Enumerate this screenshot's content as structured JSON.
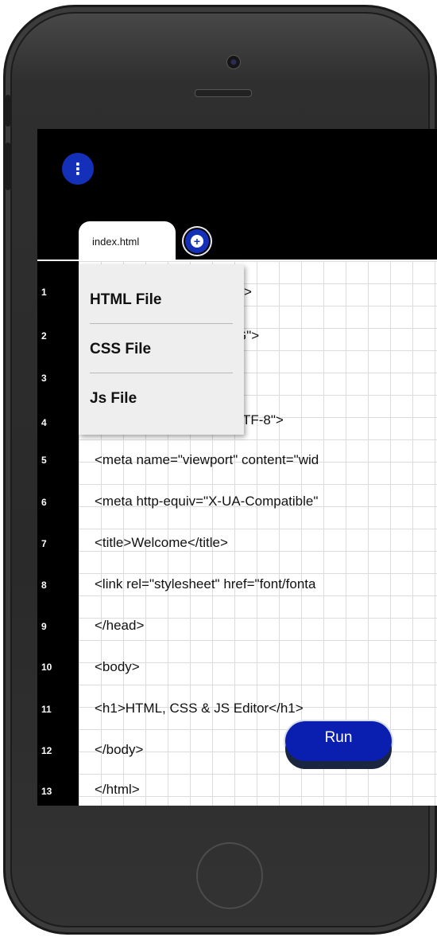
{
  "editor": {
    "tab_label": "index.html",
    "menu_glyph": "⋮",
    "add_glyph": "+",
    "line_numbers": [
      "1",
      "2",
      "3",
      "4",
      "5",
      "6",
      "7",
      "8",
      "9",
      "10",
      "11",
      "12",
      "13"
    ],
    "lines": [
      ">",
      "G\">",
      "",
      "TF-8\">",
      "<meta name=\"viewport\" content=\"wid",
      "<meta http-equiv=\"X-UA-Compatible\"",
      "<title>Welcome</title>",
      "<link rel=\"stylesheet\" href=\"font/fonta",
      "</head>",
      "<body>",
      "<h1>HTML, CSS & JS Editor</h1>",
      "</body>",
      "</html>"
    ]
  },
  "new_file_menu": {
    "items": [
      "HTML File",
      "CSS File",
      "Js File"
    ]
  },
  "run_button": {
    "label": "Run"
  },
  "colors": {
    "accent": "#1430b8",
    "run_button": "#0a1fb0",
    "editor_bg": "#ffffff",
    "screen_bg": "#000000"
  }
}
